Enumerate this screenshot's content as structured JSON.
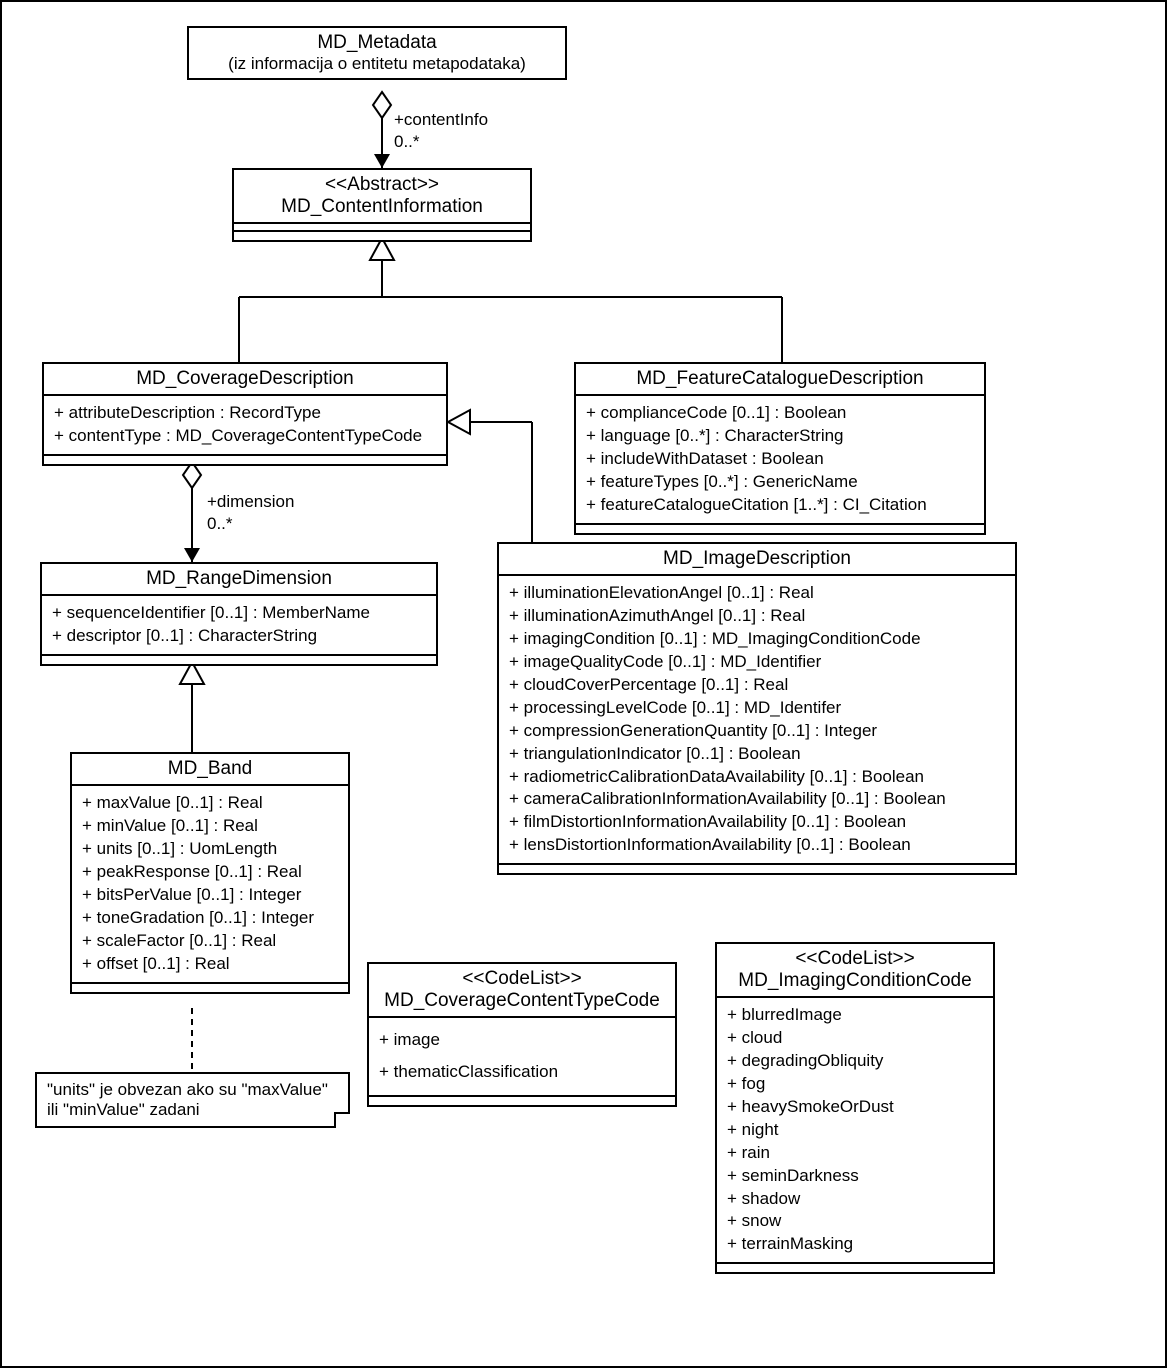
{
  "classes": {
    "md_metadata": {
      "name": "MD_Metadata",
      "subtitle": "(iz informacija o entitetu metapodataka)"
    },
    "md_contentinfo": {
      "stereotype": "<<Abstract>>",
      "name": "MD_ContentInformation"
    },
    "md_coveragedesc": {
      "name": "MD_CoverageDescription",
      "attrs": [
        "+ attributeDescription : RecordType",
        "+ contentType : MD_CoverageContentTypeCode"
      ]
    },
    "md_featurecat": {
      "name": "MD_FeatureCatalogueDescription",
      "attrs": [
        "+ complianceCode [0..1] : Boolean",
        "+ language [0..*] : CharacterString",
        "+ includeWithDataset : Boolean",
        "+ featureTypes [0..*] : GenericName",
        "+ featureCatalogueCitation [1..*] : CI_Citation"
      ]
    },
    "md_rangedim": {
      "name": "MD_RangeDimension",
      "attrs": [
        "+ sequenceIdentifier [0..1] : MemberName",
        "+ descriptor [0..1] : CharacterString"
      ]
    },
    "md_imagedesc": {
      "name": "MD_ImageDescription",
      "attrs": [
        "+ illuminationElevationAngel [0..1] : Real",
        "+ illuminationAzimuthAngel [0..1] : Real",
        "+ imagingCondition [0..1] : MD_ImagingConditionCode",
        "+ imageQualityCode [0..1] : MD_Identifier",
        "+ cloudCoverPercentage [0..1] : Real",
        "+ processingLevelCode [0..1] : MD_Identifer",
        "+ compressionGenerationQuantity [0..1] : Integer",
        "+ triangulationIndicator [0..1] : Boolean",
        "+ radiometricCalibrationDataAvailability [0..1] : Boolean",
        "+ cameraCalibrationInformationAvailability [0..1] : Boolean",
        "+ filmDistortionInformationAvailability [0..1] : Boolean",
        "+ lensDistortionInformationAvailability [0..1] : Boolean"
      ]
    },
    "md_band": {
      "name": "MD_Band",
      "attrs": [
        "+ maxValue [0..1] : Real",
        "+ minValue [0..1] : Real",
        "+ units [0..1] : UomLength",
        "+ peakResponse [0..1] : Real",
        "+ bitsPerValue [0..1] : Integer",
        "+ toneGradation [0..1] : Integer",
        "+ scaleFactor [0..1] : Real",
        "+ offset [0..1] : Real"
      ]
    },
    "md_covtypecode": {
      "stereotype": "<<CodeList>>",
      "name": "MD_CoverageContentTypeCode",
      "attrs": [
        "+ image",
        "+ thematicClassification"
      ]
    },
    "md_imgcondcode": {
      "stereotype": "<<CodeList>>",
      "name": "MD_ImagingConditionCode",
      "attrs": [
        "+ blurredImage",
        "+ cloud",
        "+ degradingObliquity",
        "+ fog",
        "+ heavySmokeOrDust",
        "+ night",
        "+ rain",
        "+ seminDarkness",
        "+ shadow",
        "+ snow",
        "+ terrainMasking"
      ]
    }
  },
  "labels": {
    "contentInfo_role": "+contentInfo",
    "contentInfo_mult": "0..*",
    "dimension_role": "+dimension",
    "dimension_mult": "0..*"
  },
  "note": {
    "text1": "\"units\" je obvezan ako su \"maxValue\"",
    "text2": "ili \"minValue\" zadani"
  }
}
